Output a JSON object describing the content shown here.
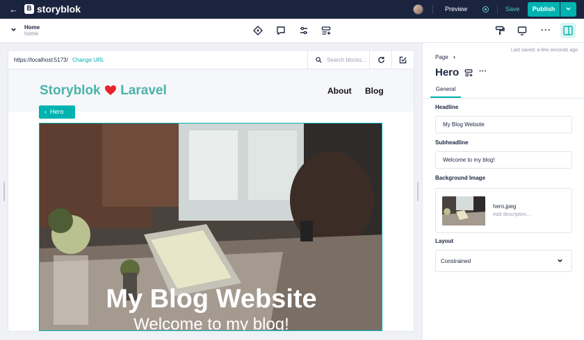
{
  "topbar": {
    "back_icon": "arrow-left-icon",
    "logo_letter": "B",
    "logo_text": "storyblok",
    "preview_label": "Preview",
    "save_label": "Save",
    "publish_label": "Publish",
    "publish_dropdown_icon": "chevron-down-icon"
  },
  "story": {
    "name": "Home",
    "slug": "home"
  },
  "browser": {
    "url": "https://localhost:5173/",
    "change_url_label": "Change URL",
    "search_placeholder": "Search blocks..."
  },
  "site": {
    "logo_text_before": "Storyblok",
    "logo_text_after": "Laravel",
    "nav": [
      "About",
      "Blog"
    ],
    "hero_tag": "Hero",
    "hero_title": "My Blog Website",
    "hero_subtitle": "Welcome to my blog!"
  },
  "panel": {
    "last_saved": "Last saved: a few seconds ago",
    "breadcrumb": "Page",
    "component_title": "Hero",
    "tab_general": "General",
    "headline_label": "Headline",
    "headline_value": "My Blog Website",
    "subheadline_label": "Subheadline",
    "subheadline_value": "Welcome to my blog!",
    "background_label": "Background Image",
    "asset_name": "hero.jpeg",
    "asset_desc_placeholder": "Add description...",
    "layout_label": "Layout",
    "layout_value": "Constrained"
  },
  "colors": {
    "topbar_bg": "#1b243f",
    "accent": "#00b3b0",
    "site_logo": "#4bb3a8"
  }
}
